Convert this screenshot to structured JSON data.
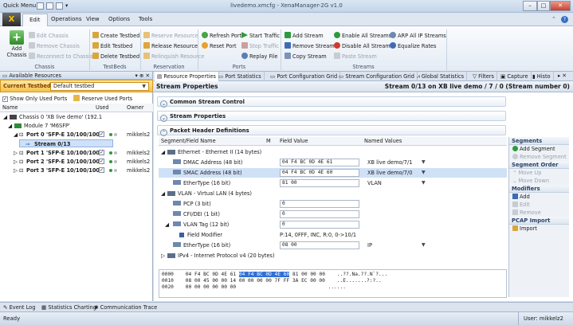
{
  "window": {
    "quick_menu": "Quick Menu",
    "title": "livedemo.xmcfg - XenaManager-2G v1.0",
    "min": "–",
    "max": "□",
    "close": "✕"
  },
  "logo_text": "X",
  "menu": {
    "edit": "Edit",
    "operations": "Operations",
    "view": "View",
    "options": "Options",
    "tools": "Tools"
  },
  "ribbon": {
    "add_chassis": "Add Chassis",
    "edit_chassis": "Edit Chassis",
    "remove_chassis": "Remove Chassis",
    "reconnect": "Reconnect to Chassis",
    "create_testbed": "Create Testbed",
    "edit_testbed": "Edit Testbed",
    "delete_testbed": "Delete Testbed",
    "reserve_resource": "Reserve Resource",
    "release_resource": "Release Resource",
    "relinquish_resource": "Relinquish Resource",
    "refresh_port": "Refresh Port",
    "reset_port": "Reset Port",
    "start_traffic": "Start Traffic",
    "stop_traffic": "Stop Traffic",
    "replay_file": "Replay File",
    "add_stream": "Add Stream",
    "remove_stream": "Remove Stream",
    "copy_stream": "Copy Stream",
    "enable_all": "Enable All Streams",
    "disable_all": "Disable All Streams",
    "paste_stream": "Paste Stream",
    "arp_all": "ARP All IP Streams",
    "equalize": "Equalize Rates",
    "groups": {
      "chassis": "Chassis",
      "testbeds": "TestBeds",
      "reservation": "Reservation",
      "ports": "Ports",
      "streams": "Streams"
    }
  },
  "left": {
    "header": "Available Resources",
    "header_ctrl": "▾ ⊕ ✕",
    "testbed_label": "Current Testbed:",
    "testbed_value": "Default testbed",
    "show_only_used": "Show Only Used Ports",
    "reserve_used": "Reserve Used Ports",
    "columns": {
      "name": "Name",
      "used": "Used",
      "owner": "Owner"
    },
    "tree": [
      {
        "label": "Chassis 0 'XB live demo' (192.1",
        "owner": ""
      },
      {
        "label": "Module 7 'M6SFP'",
        "owner": ""
      },
      {
        "label": "Port 0 'SFP-E 10/100/100",
        "owner": "mikkels2"
      },
      {
        "label": "Stream 0/13",
        "owner": ""
      },
      {
        "label": "Port 1 'SFP-E 10/100/100",
        "owner": "mikkels2"
      },
      {
        "label": "Port 2 'SFP-E 10/100/100",
        "owner": "mikkels2"
      },
      {
        "label": "Port 3 'SFP-E 10/100/100",
        "owner": "mikkels2"
      }
    ]
  },
  "tabs": [
    "Resource Properties",
    "Port Statistics",
    "Port Configuration Grid",
    "Stream Configuration Grid",
    "Global Statistics",
    "Filters",
    "Capture",
    "Histo"
  ],
  "tab_ctrl": "▸ ✕",
  "stream_props": {
    "title": "Stream Properties",
    "subtitle": "Stream 0/13 on XB live demo / 7 / 0 (Stream number 0)",
    "sec_common": "Common Stream Control",
    "sec_props": "Stream Properties",
    "sec_packet": "Packet Header Definitions"
  },
  "grid": {
    "headers": {
      "field": "Segment/Field Name",
      "m": "M",
      "value": "Field Value",
      "named": "Named Values"
    },
    "rows": [
      {
        "name": "Ethernet - Ethernet II (14 bytes)",
        "value": "",
        "named": ""
      },
      {
        "name": "DMAC Address (48 bit)",
        "value": "04 F4 BC 0D 4E 61",
        "named": "XB live demo/7/1"
      },
      {
        "name": "SMAC Address (48 bit)",
        "value": "04 F4 BC 0D 4E 60",
        "named": "XB live demo/7/0"
      },
      {
        "name": "EtherType (16 bit)",
        "value": "81 00",
        "named": "VLAN"
      },
      {
        "name": "VLAN - Virtual LAN (4 bytes)",
        "value": "",
        "named": ""
      },
      {
        "name": "PCP (3 bit)",
        "value": "0",
        "named": ""
      },
      {
        "name": "CFI/DEI (1 bit)",
        "value": "0",
        "named": ""
      },
      {
        "name": "VLAN Tag (12 bit)",
        "value": "0",
        "named": ""
      },
      {
        "name": "Field Modifier",
        "value": "P:14, 0FFF, INC, R:0, 0->10/1",
        "named": ""
      },
      {
        "name": "EtherType (16 bit)",
        "value": "08 00",
        "named": "IP"
      },
      {
        "name": "IPv4 - Internet Protocol v4 (20 bytes)",
        "value": "",
        "named": ""
      }
    ]
  },
  "hex": {
    "l1_off": "0000",
    "l1_a": "04 F4 BC 0D 4E 61",
    "l1_b": "04 F4 BC 0D 4E 60",
    "l1_c": "81 00 00 00",
    "l1_ascii": "..??.Na.??.N`?...",
    "l2": "0010    08 00 45 00 00 14 00 00 00 00 7F FF 3A EC 00 00    ..E.......?:?..",
    "l3": "0020    00 00 00 00 00 00                               ......"
  },
  "segments": {
    "h_segments": "Segments",
    "add_segment": "Add Segment",
    "remove_segment": "Remove Segment",
    "h_order": "Segment Order",
    "move_up": "Move Up",
    "move_down": "Move Down",
    "h_modifiers": "Modifiers",
    "add": "Add",
    "edit": "Edit",
    "remove": "Remove",
    "h_pcap": "PCAP Import",
    "import": "Import"
  },
  "bottom_tabs": {
    "event_log": "Event Log",
    "stats_chart": "Statistics Charting",
    "comm_trace": "Communication Trace"
  },
  "status": {
    "ready": "Ready",
    "user": "User: mikkelz2"
  }
}
